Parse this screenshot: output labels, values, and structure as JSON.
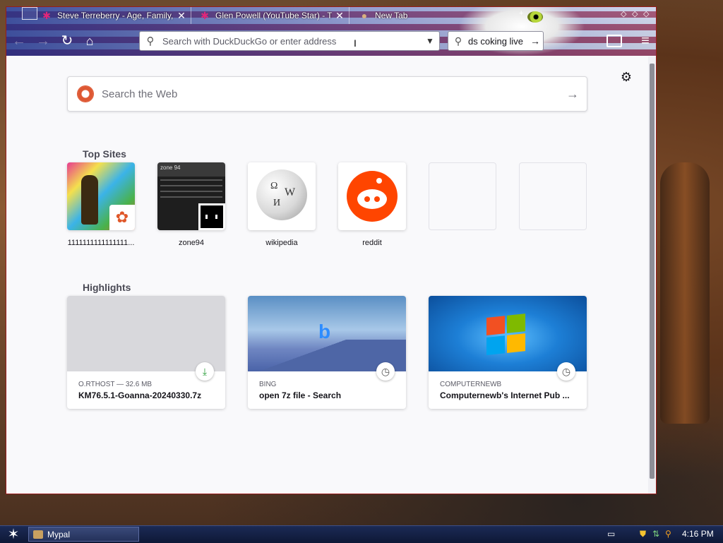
{
  "browser": {
    "tabs": [
      {
        "title": "Steve Terreberry - Age, Family, B",
        "favicon": "star-icon",
        "active": false
      },
      {
        "title": "Glen Powell (YouTube Star) - Trivia",
        "favicon": "star-icon",
        "active": false
      },
      {
        "title": "New Tab",
        "favicon": "eagle-icon",
        "active": true
      }
    ],
    "url_placeholder": "Search with DuckDuckGo or enter address",
    "search_box_value": "ds coking live"
  },
  "newtab": {
    "web_search_placeholder": "Search the Web",
    "top_sites_heading": "Top Sites",
    "top_sites": [
      {
        "label": "1111111111111111..."
      },
      {
        "label": "zone94",
        "thumb_header": "zone 94"
      },
      {
        "label": "wikipedia"
      },
      {
        "label": "reddit"
      },
      {
        "label": ""
      },
      {
        "label": ""
      }
    ],
    "highlights_heading": "Highlights",
    "highlights": [
      {
        "source": "O.RTHOST — 32.6 MB",
        "title": "KM76.5.1-Goanna-20240330.7z",
        "badge": "download-icon"
      },
      {
        "source": "BING",
        "title": "open 7z file - Search",
        "badge": "clock-icon"
      },
      {
        "source": "COMPUTERNEWB",
        "title": "Computernewb's Internet Pub ...",
        "badge": "clock-icon"
      }
    ]
  },
  "taskbar": {
    "task_label": "Mypal",
    "clock": "4:16 PM"
  },
  "colors": {
    "accent_orange": "#de5833",
    "reddit": "#ff4500",
    "download_green": "#2a9d3a"
  }
}
